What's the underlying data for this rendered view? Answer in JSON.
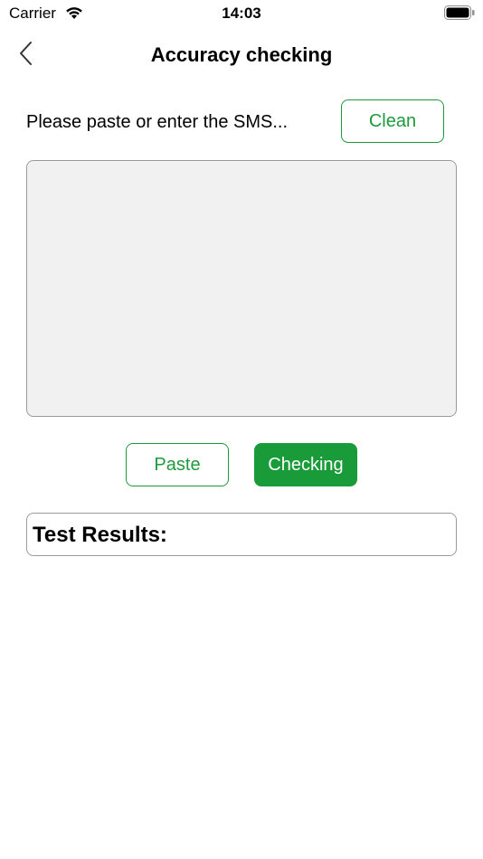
{
  "status_bar": {
    "carrier": "Carrier",
    "time": "14:03",
    "wifi_icon": "wifi-icon",
    "battery_icon": "battery-icon"
  },
  "nav": {
    "back_icon": "chevron-left-icon",
    "title": "Accuracy checking"
  },
  "prompt": {
    "text": "Please paste or enter the SMS...",
    "clean_label": "Clean"
  },
  "sms_input": {
    "value": "",
    "placeholder": ""
  },
  "actions": {
    "paste_label": "Paste",
    "checking_label": "Checking"
  },
  "results": {
    "label": "Test Results:"
  },
  "colors": {
    "accent": "#1a9b3a",
    "input_background": "#f1f1f1",
    "border": "#9a9a9a"
  }
}
